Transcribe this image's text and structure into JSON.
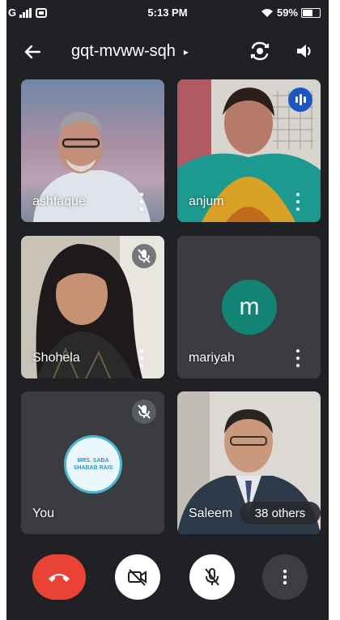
{
  "status_bar": {
    "network": "G",
    "time": "5:13 PM",
    "battery": "59%"
  },
  "header": {
    "meeting_code": "gqt-mvww-sqh",
    "caret": "▸"
  },
  "participants": [
    {
      "name": "ashfaque",
      "muted": false,
      "video": true
    },
    {
      "name": "anjum",
      "muted": false,
      "video": true,
      "speaking": true
    },
    {
      "name": "Shohela",
      "muted": true,
      "video": true
    },
    {
      "name": "mariyah",
      "muted": false,
      "video": false,
      "avatar_letter": "m",
      "avatar_color": "#128476"
    },
    {
      "name": "You",
      "muted": true,
      "video": false,
      "avatar_text": "MRS. SABA SHABAB RAIS"
    },
    {
      "name": "Saleem",
      "muted": false,
      "video": true
    }
  ],
  "others_label": "38 others",
  "colors": {
    "end_call": "#ea4335",
    "speaking": "#1a57c5",
    "background": "#1f2125"
  }
}
